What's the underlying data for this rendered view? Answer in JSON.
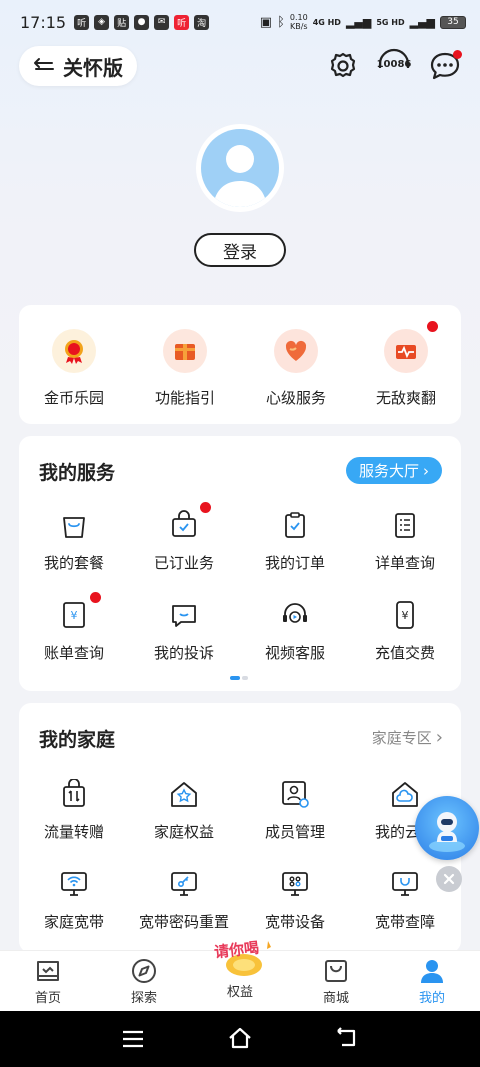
{
  "status_bar": {
    "time": "17:15",
    "net_speed": "0.10\nKB/s",
    "network_a": "4G HD",
    "network_b": "5G HD",
    "battery": "35"
  },
  "header": {
    "care_mode_label": "关怀版",
    "service_number": "10086"
  },
  "profile": {
    "login_label": "登录"
  },
  "quick_entries": [
    {
      "label": "金币乐园",
      "icon": "gold-coin-icon",
      "color": "#e8a21a"
    },
    {
      "label": "功能指引",
      "icon": "guide-gift-icon",
      "color": "#e85a24"
    },
    {
      "label": "心级服务",
      "icon": "heart-service-icon",
      "color": "#ef6a3a"
    },
    {
      "label": "无敌爽翻",
      "icon": "pulse-box-icon",
      "color": "#e84a24",
      "badge": true
    }
  ],
  "services": {
    "title": "我的服务",
    "hall_label": "服务大厅",
    "items": [
      {
        "label": "我的套餐",
        "icon": "bag-icon"
      },
      {
        "label": "已订业务",
        "icon": "subscribed-bag-icon",
        "badge": true
      },
      {
        "label": "我的订单",
        "icon": "order-clipboard-icon"
      },
      {
        "label": "详单查询",
        "icon": "detail-list-icon"
      },
      {
        "label": "账单查询",
        "icon": "bill-icon",
        "badge": true
      },
      {
        "label": "我的投诉",
        "icon": "complaint-message-icon"
      },
      {
        "label": "视频客服",
        "icon": "video-support-icon"
      },
      {
        "label": "充值交费",
        "icon": "recharge-phone-icon"
      }
    ]
  },
  "family": {
    "title": "我的家庭",
    "zone_label": "家庭专区",
    "items": [
      {
        "label": "流量转赠",
        "icon": "data-transfer-icon"
      },
      {
        "label": "家庭权益",
        "icon": "family-benefit-icon"
      },
      {
        "label": "成员管理",
        "icon": "member-manage-icon"
      },
      {
        "label": "我的云盘",
        "icon": "cloud-home-icon"
      },
      {
        "label": "家庭宽带",
        "icon": "broadband-icon"
      },
      {
        "label": "宽带密码重置",
        "icon": "password-reset-icon"
      },
      {
        "label": "宽带设备",
        "icon": "broadband-device-icon"
      },
      {
        "label": "宽带查障",
        "icon": "broadband-repair-icon"
      }
    ]
  },
  "tabs": [
    {
      "label": "首页",
      "icon": "home-icon"
    },
    {
      "label": "探索",
      "icon": "compass-icon"
    },
    {
      "label": "权益",
      "icon": "benefit-promo-icon",
      "promo_text": "请你喝"
    },
    {
      "label": "商城",
      "icon": "shop-bag-icon"
    },
    {
      "label": "我的",
      "icon": "profile-icon",
      "active": true
    }
  ],
  "colors": {
    "accent": "#38a8f5",
    "active_tab": "#2a94f0",
    "badge": "#e8131e"
  }
}
